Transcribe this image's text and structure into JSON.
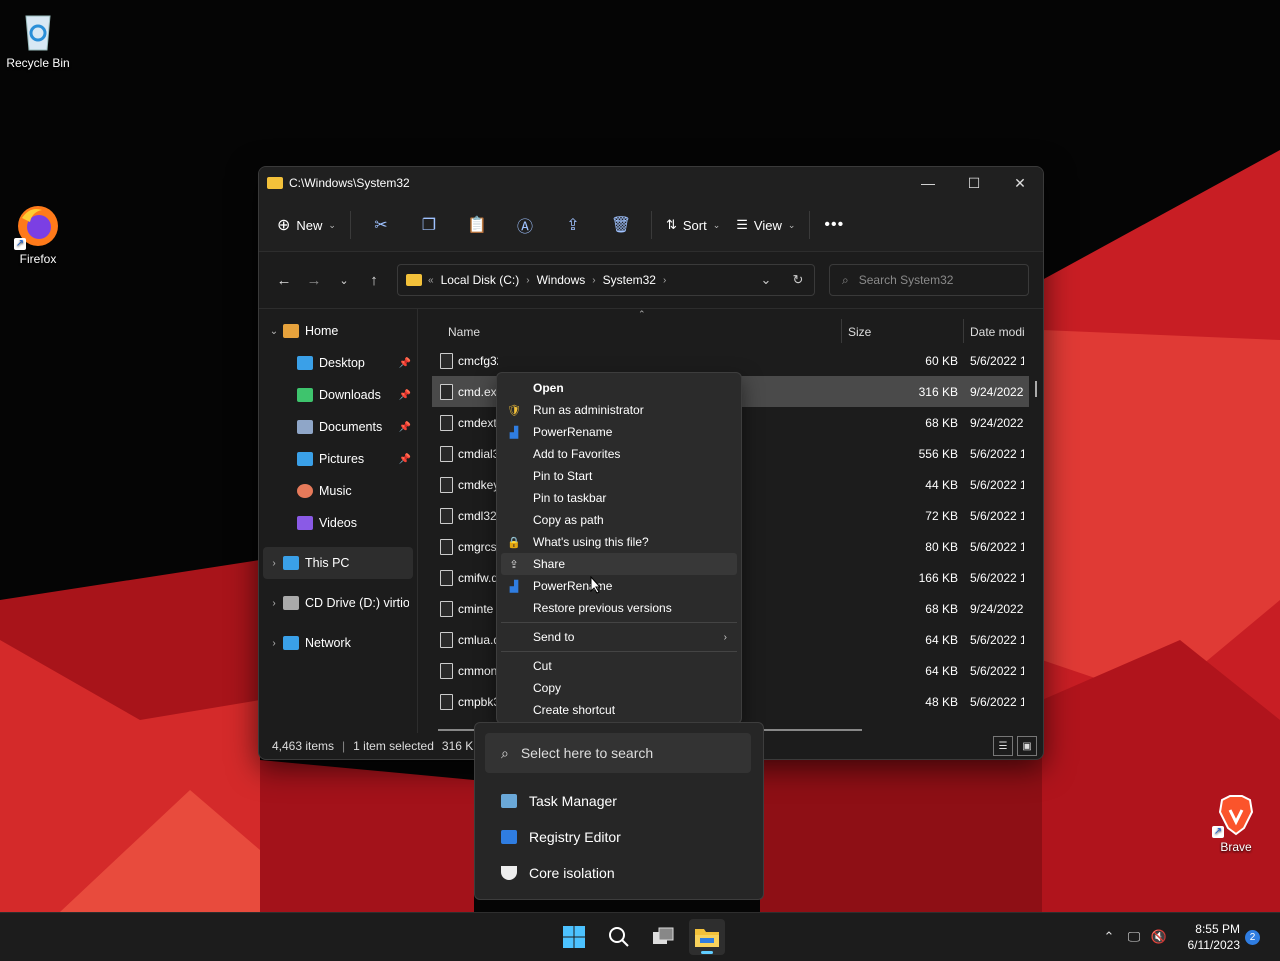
{
  "desktop": {
    "icons": [
      {
        "label": "Recycle Bin"
      },
      {
        "label": "Firefox"
      },
      {
        "label": "Brave"
      }
    ]
  },
  "window": {
    "title": "C:\\Windows\\System32",
    "toolbar": {
      "new_label": "New",
      "sort_label": "Sort",
      "view_label": "View"
    },
    "breadcrumb": [
      "Local Disk (C:)",
      "Windows",
      "System32"
    ],
    "search_placeholder": "Search System32",
    "sidebar": {
      "home": "Home",
      "quick": [
        {
          "label": "Desktop",
          "color": "#3aa0e8"
        },
        {
          "label": "Downloads",
          "color": "#3ec46d"
        },
        {
          "label": "Documents",
          "color": "#8fa6c8"
        },
        {
          "label": "Pictures",
          "color": "#3aa0e8"
        },
        {
          "label": "Music",
          "color": "#e67a5a"
        },
        {
          "label": "Videos",
          "color": "#8a5ae6"
        }
      ],
      "this_pc": "This PC",
      "cd_drive": "CD Drive (D:) virtio-",
      "network": "Network"
    },
    "columns": {
      "name": "Name",
      "size": "Size",
      "date": "Date modi"
    },
    "files": [
      {
        "name": "cmcfg32.dll",
        "size": "60 KB",
        "date": "5/6/2022 1"
      },
      {
        "name": "cmd.ex",
        "size": "316 KB",
        "date": "9/24/2022",
        "selected": true
      },
      {
        "name": "cmdext",
        "size": "68 KB",
        "date": "9/24/2022"
      },
      {
        "name": "cmdial3",
        "size": "556 KB",
        "date": "5/6/2022 1"
      },
      {
        "name": "cmdkey",
        "size": "44 KB",
        "date": "5/6/2022 1"
      },
      {
        "name": "cmdl32",
        "size": "72 KB",
        "date": "5/6/2022 1"
      },
      {
        "name": "cmgrcs",
        "size": "80 KB",
        "date": "5/6/2022 1"
      },
      {
        "name": "cmifw.d",
        "size": "166 KB",
        "date": "5/6/2022 1"
      },
      {
        "name": "cminte",
        "size": "68 KB",
        "date": "9/24/2022"
      },
      {
        "name": "cmlua.d",
        "size": "64 KB",
        "date": "5/6/2022 1"
      },
      {
        "name": "cmmon",
        "size": "64 KB",
        "date": "5/6/2022 1"
      },
      {
        "name": "cmpbk3",
        "size": "48 KB",
        "date": "5/6/2022 1"
      }
    ],
    "status": {
      "items": "4,463 items",
      "selected": "1 item selected",
      "size": "316 KB"
    }
  },
  "context_menu": {
    "items": [
      {
        "label": "Open",
        "bold": true
      },
      {
        "label": "Run as administrator",
        "icon": "shield-icon"
      },
      {
        "label": "PowerRename",
        "icon": "powerrename-icon"
      },
      {
        "label": "Add to Favorites"
      },
      {
        "label": "Pin to Start"
      },
      {
        "label": "Pin to taskbar"
      },
      {
        "label": "Copy as path"
      },
      {
        "label": "What's using this file?",
        "icon": "lock-icon"
      },
      {
        "label": "Share",
        "icon": "share-icon"
      },
      {
        "label": "PowerRename",
        "icon": "powerrename-icon"
      },
      {
        "label": "Restore previous versions"
      },
      {
        "label": "Send to"
      },
      {
        "label": "Cut"
      },
      {
        "label": "Copy"
      },
      {
        "label": "Create shortcut"
      }
    ]
  },
  "search_flyout": {
    "placeholder": "Select here to search",
    "items": [
      "Task Manager",
      "Registry Editor",
      "Core isolation"
    ]
  },
  "taskbar": {
    "time": "8:55 PM",
    "date": "6/11/2023",
    "notifications": "2"
  }
}
